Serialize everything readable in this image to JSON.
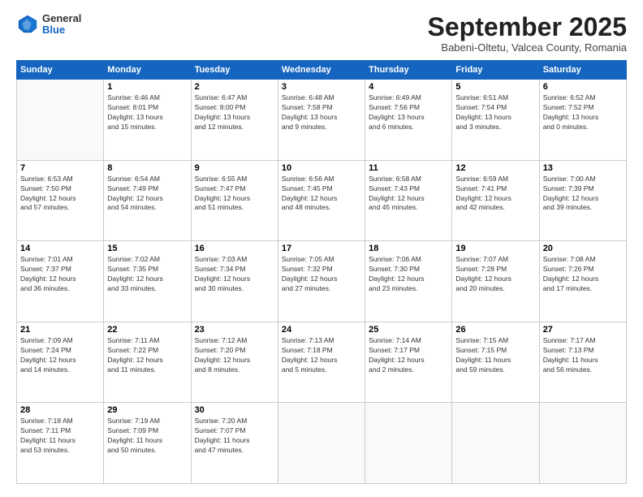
{
  "logo": {
    "general": "General",
    "blue": "Blue"
  },
  "header": {
    "month": "September 2025",
    "location": "Babeni-Oltetu, Valcea County, Romania"
  },
  "days_of_week": [
    "Sunday",
    "Monday",
    "Tuesday",
    "Wednesday",
    "Thursday",
    "Friday",
    "Saturday"
  ],
  "weeks": [
    [
      {
        "day": "",
        "info": ""
      },
      {
        "day": "1",
        "info": "Sunrise: 6:46 AM\nSunset: 8:01 PM\nDaylight: 13 hours\nand 15 minutes."
      },
      {
        "day": "2",
        "info": "Sunrise: 6:47 AM\nSunset: 8:00 PM\nDaylight: 13 hours\nand 12 minutes."
      },
      {
        "day": "3",
        "info": "Sunrise: 6:48 AM\nSunset: 7:58 PM\nDaylight: 13 hours\nand 9 minutes."
      },
      {
        "day": "4",
        "info": "Sunrise: 6:49 AM\nSunset: 7:56 PM\nDaylight: 13 hours\nand 6 minutes."
      },
      {
        "day": "5",
        "info": "Sunrise: 6:51 AM\nSunset: 7:54 PM\nDaylight: 13 hours\nand 3 minutes."
      },
      {
        "day": "6",
        "info": "Sunrise: 6:52 AM\nSunset: 7:52 PM\nDaylight: 13 hours\nand 0 minutes."
      }
    ],
    [
      {
        "day": "7",
        "info": "Sunrise: 6:53 AM\nSunset: 7:50 PM\nDaylight: 12 hours\nand 57 minutes."
      },
      {
        "day": "8",
        "info": "Sunrise: 6:54 AM\nSunset: 7:49 PM\nDaylight: 12 hours\nand 54 minutes."
      },
      {
        "day": "9",
        "info": "Sunrise: 6:55 AM\nSunset: 7:47 PM\nDaylight: 12 hours\nand 51 minutes."
      },
      {
        "day": "10",
        "info": "Sunrise: 6:56 AM\nSunset: 7:45 PM\nDaylight: 12 hours\nand 48 minutes."
      },
      {
        "day": "11",
        "info": "Sunrise: 6:58 AM\nSunset: 7:43 PM\nDaylight: 12 hours\nand 45 minutes."
      },
      {
        "day": "12",
        "info": "Sunrise: 6:59 AM\nSunset: 7:41 PM\nDaylight: 12 hours\nand 42 minutes."
      },
      {
        "day": "13",
        "info": "Sunrise: 7:00 AM\nSunset: 7:39 PM\nDaylight: 12 hours\nand 39 minutes."
      }
    ],
    [
      {
        "day": "14",
        "info": "Sunrise: 7:01 AM\nSunset: 7:37 PM\nDaylight: 12 hours\nand 36 minutes."
      },
      {
        "day": "15",
        "info": "Sunrise: 7:02 AM\nSunset: 7:35 PM\nDaylight: 12 hours\nand 33 minutes."
      },
      {
        "day": "16",
        "info": "Sunrise: 7:03 AM\nSunset: 7:34 PM\nDaylight: 12 hours\nand 30 minutes."
      },
      {
        "day": "17",
        "info": "Sunrise: 7:05 AM\nSunset: 7:32 PM\nDaylight: 12 hours\nand 27 minutes."
      },
      {
        "day": "18",
        "info": "Sunrise: 7:06 AM\nSunset: 7:30 PM\nDaylight: 12 hours\nand 23 minutes."
      },
      {
        "day": "19",
        "info": "Sunrise: 7:07 AM\nSunset: 7:28 PM\nDaylight: 12 hours\nand 20 minutes."
      },
      {
        "day": "20",
        "info": "Sunrise: 7:08 AM\nSunset: 7:26 PM\nDaylight: 12 hours\nand 17 minutes."
      }
    ],
    [
      {
        "day": "21",
        "info": "Sunrise: 7:09 AM\nSunset: 7:24 PM\nDaylight: 12 hours\nand 14 minutes."
      },
      {
        "day": "22",
        "info": "Sunrise: 7:11 AM\nSunset: 7:22 PM\nDaylight: 12 hours\nand 11 minutes."
      },
      {
        "day": "23",
        "info": "Sunrise: 7:12 AM\nSunset: 7:20 PM\nDaylight: 12 hours\nand 8 minutes."
      },
      {
        "day": "24",
        "info": "Sunrise: 7:13 AM\nSunset: 7:18 PM\nDaylight: 12 hours\nand 5 minutes."
      },
      {
        "day": "25",
        "info": "Sunrise: 7:14 AM\nSunset: 7:17 PM\nDaylight: 12 hours\nand 2 minutes."
      },
      {
        "day": "26",
        "info": "Sunrise: 7:15 AM\nSunset: 7:15 PM\nDaylight: 11 hours\nand 59 minutes."
      },
      {
        "day": "27",
        "info": "Sunrise: 7:17 AM\nSunset: 7:13 PM\nDaylight: 11 hours\nand 56 minutes."
      }
    ],
    [
      {
        "day": "28",
        "info": "Sunrise: 7:18 AM\nSunset: 7:11 PM\nDaylight: 11 hours\nand 53 minutes."
      },
      {
        "day": "29",
        "info": "Sunrise: 7:19 AM\nSunset: 7:09 PM\nDaylight: 11 hours\nand 50 minutes."
      },
      {
        "day": "30",
        "info": "Sunrise: 7:20 AM\nSunset: 7:07 PM\nDaylight: 11 hours\nand 47 minutes."
      },
      {
        "day": "",
        "info": ""
      },
      {
        "day": "",
        "info": ""
      },
      {
        "day": "",
        "info": ""
      },
      {
        "day": "",
        "info": ""
      }
    ]
  ]
}
